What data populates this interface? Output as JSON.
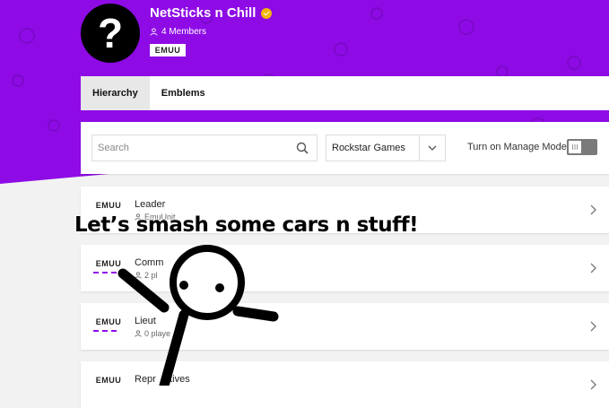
{
  "crew": {
    "avatar_symbol": "?",
    "name": "NetSticks n Chill",
    "members": "4 Members",
    "tag": "EMUU"
  },
  "tabs": [
    {
      "label": "Hierarchy",
      "active": true
    },
    {
      "label": "Emblems",
      "active": false
    }
  ],
  "filters": {
    "search_placeholder": "Search",
    "platform": "Rockstar Games",
    "manage_mode_label": "Turn on Manage Mode"
  },
  "ranks": [
    {
      "tag": "EMUU",
      "name": "Leader",
      "sub": "EmuUnit"
    },
    {
      "tag": "EMUU",
      "name": "Comm",
      "sub": "2 pl"
    },
    {
      "tag": "EMUU",
      "name": "Lieut",
      "sub": "0 playe"
    },
    {
      "tag": "EMUU",
      "name": "Repr",
      "name_rest": "atives",
      "sub": ""
    }
  ],
  "overlay": {
    "caption": "Let’s smash some cars n stuff!"
  },
  "colors": {
    "brand_purple": "#8e0be6",
    "badge_gold": "#f2b705"
  }
}
